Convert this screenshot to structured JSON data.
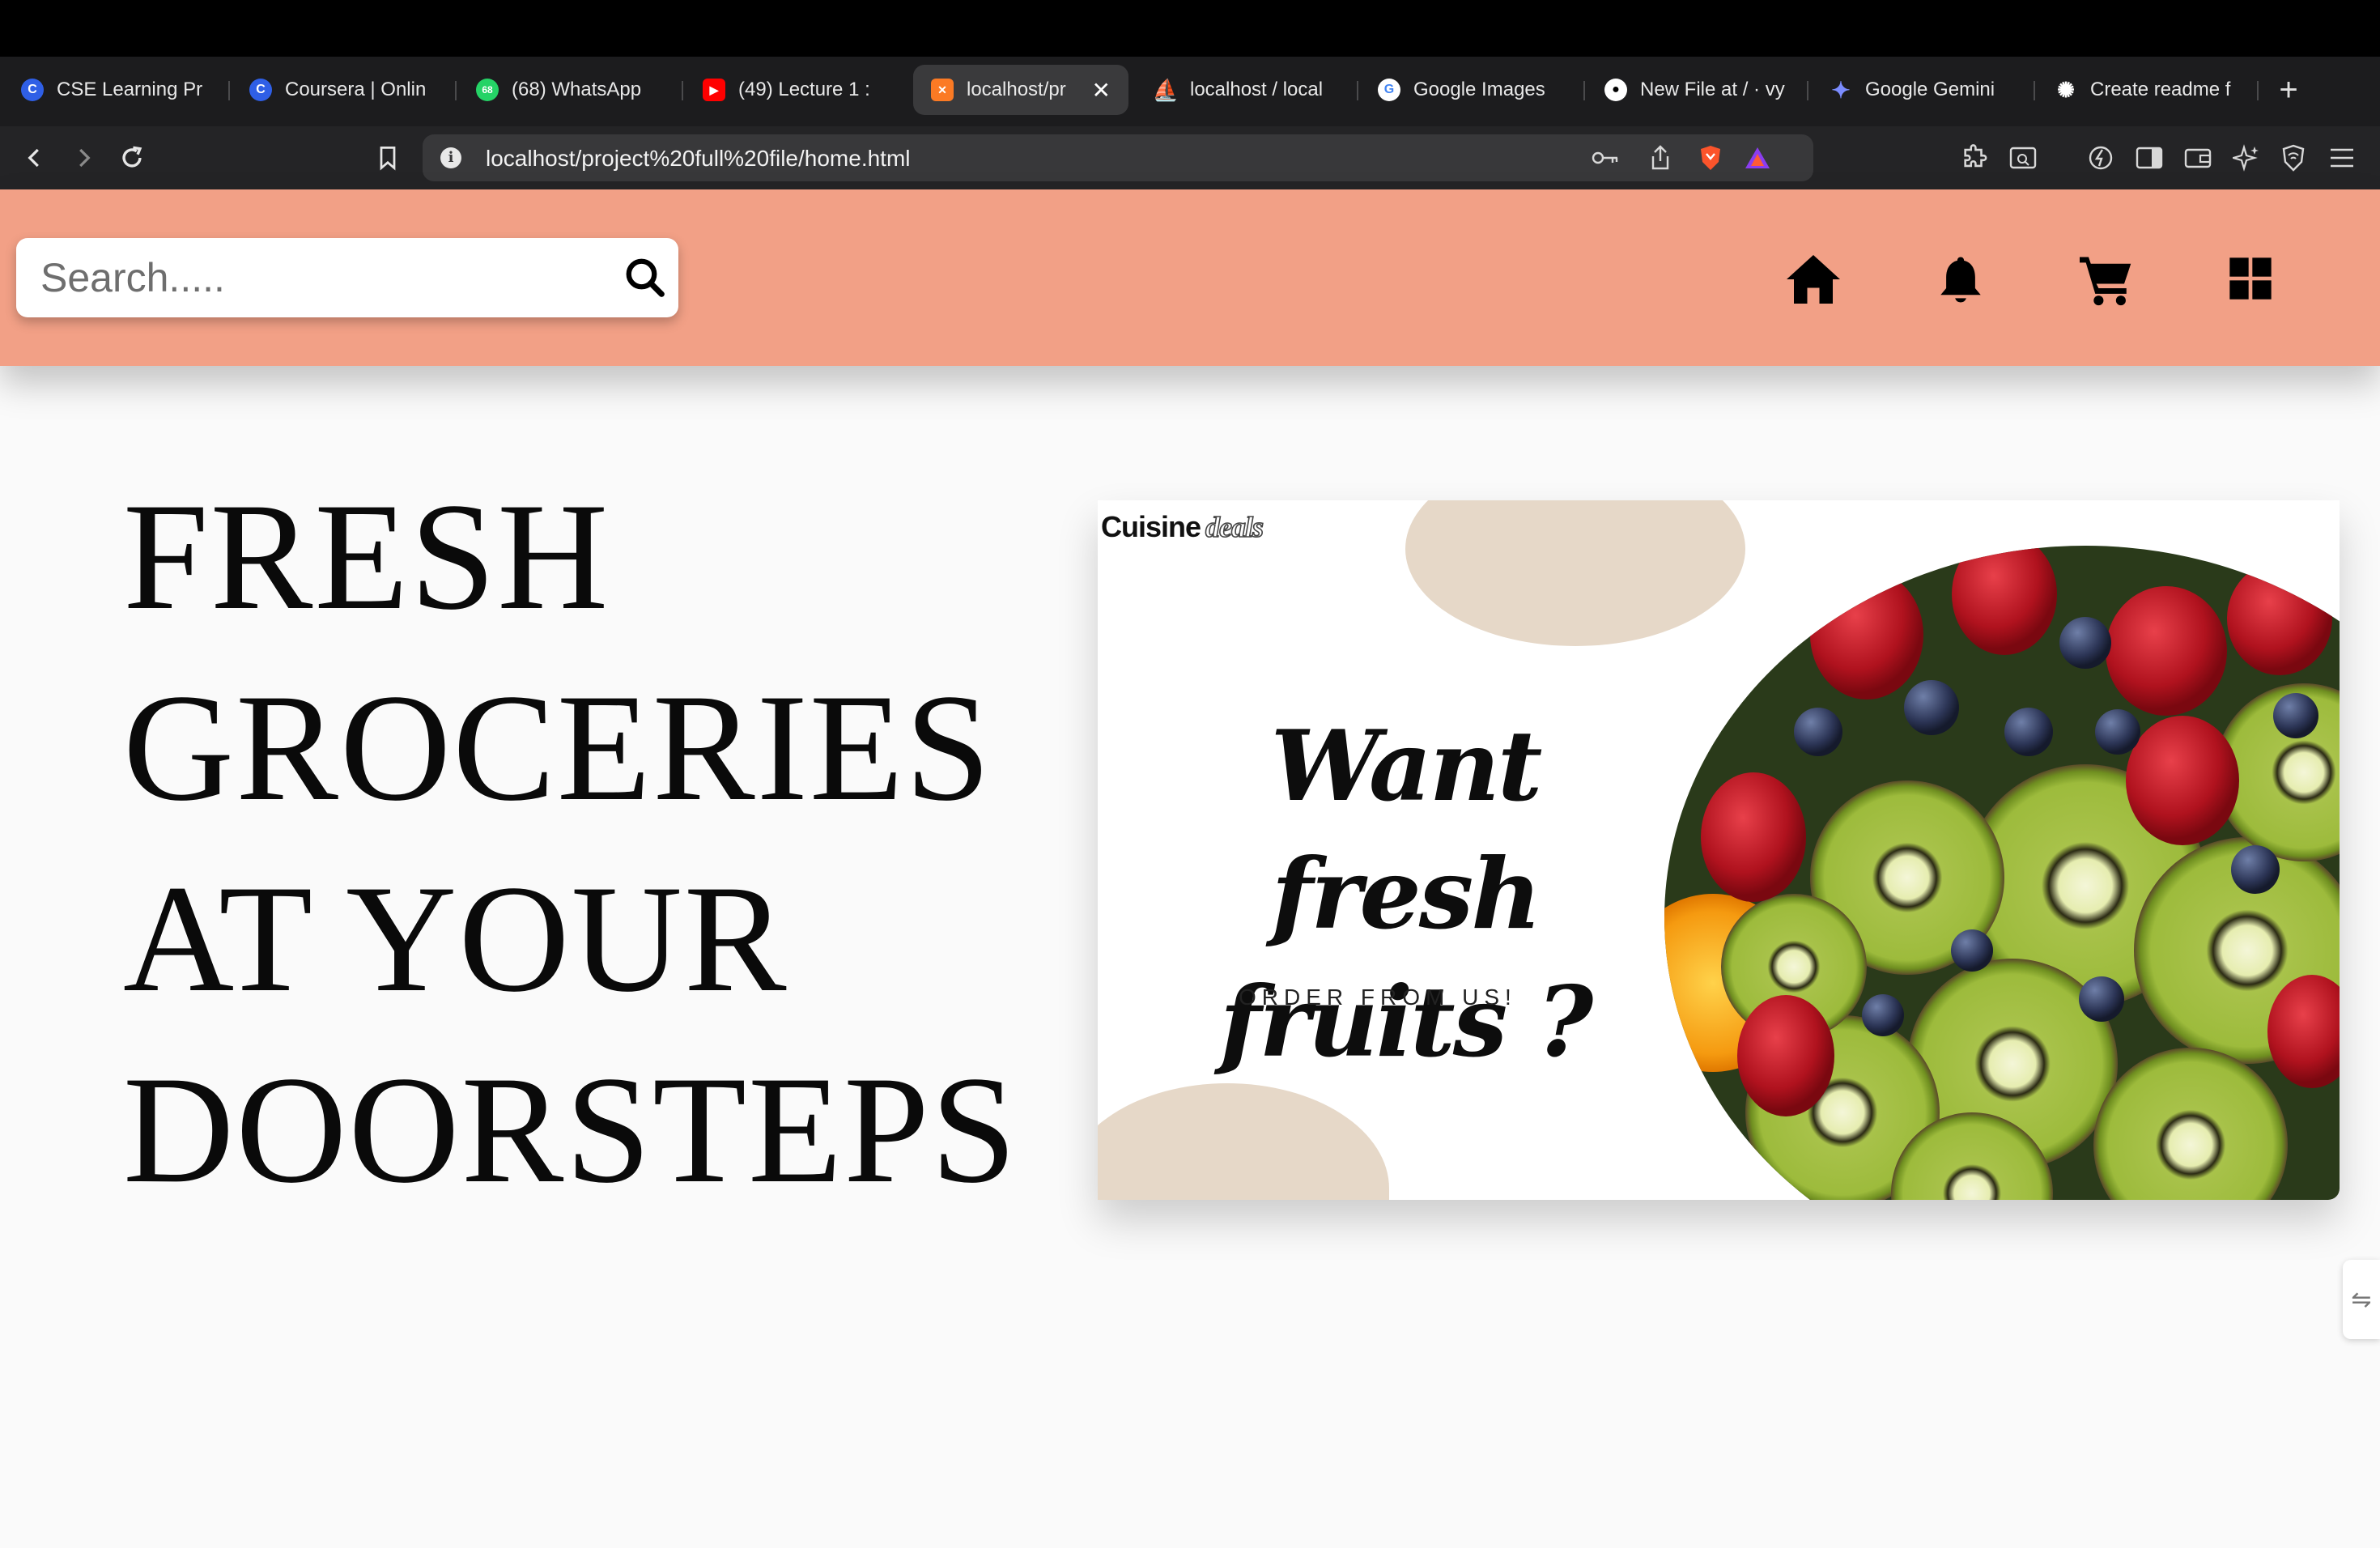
{
  "browser": {
    "tabs": [
      {
        "label": "CSE Learning Pr",
        "favicon": "c-icon",
        "color": "#2f5fe6"
      },
      {
        "label": "Coursera | Onlin",
        "favicon": "c-icon",
        "color": "#2f5fe6"
      },
      {
        "label": "(68) WhatsApp",
        "favicon": "whatsapp-icon",
        "color": "#25d366"
      },
      {
        "label": "(49) Lecture 1 :",
        "favicon": "youtube-icon",
        "color": "#ff0000"
      },
      {
        "label": "localhost/pr",
        "favicon": "xampp-icon",
        "color": "#fb7a24",
        "active": true
      },
      {
        "label": "localhost / local",
        "favicon": "phpmyadmin-icon",
        "color": "#f0a030"
      },
      {
        "label": "Google Images",
        "favicon": "google-icon",
        "color": "#4285f4"
      },
      {
        "label": "New File at / · vy",
        "favicon": "github-icon",
        "color": "#ffffff"
      },
      {
        "label": "Google Gemini",
        "favicon": "gemini-icon",
        "color": "#7b8cff"
      },
      {
        "label": "Create readme f",
        "favicon": "openai-icon",
        "color": "#ffffff"
      }
    ],
    "url": "localhost/project%20full%20file/home.html"
  },
  "header": {
    "search_placeholder": "Search.....",
    "bg_color": "#f2a086",
    "icons": [
      "home-icon",
      "bell-icon",
      "cart-icon",
      "grid-icon"
    ]
  },
  "hero": {
    "title_lines": [
      "FRESH",
      "GROCERIES",
      "AT YOUR",
      "DOORSTEPS"
    ]
  },
  "banner": {
    "logo_main": "Cuisine",
    "logo_accent": "deals",
    "headline_line1": "Want fresh",
    "headline_line2": "fruits ?",
    "subtext": "ORDER FROM US!"
  }
}
